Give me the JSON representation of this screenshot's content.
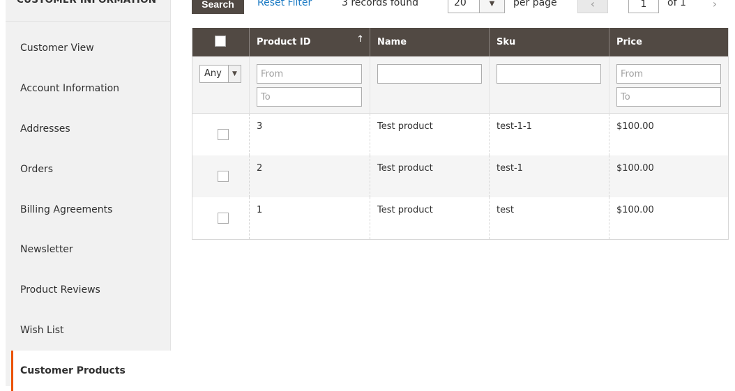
{
  "sidebar": {
    "title": "Customer Information",
    "items": [
      {
        "label": "Customer View"
      },
      {
        "label": "Account Information"
      },
      {
        "label": "Addresses"
      },
      {
        "label": "Orders"
      },
      {
        "label": "Billing Agreements"
      },
      {
        "label": "Newsletter"
      },
      {
        "label": "Product Reviews"
      },
      {
        "label": "Wish List"
      },
      {
        "label": "Customer Products"
      }
    ],
    "active_item": "Customer Products"
  },
  "toolbar": {
    "search_label": "Search",
    "reset_label": "Reset Filter",
    "records_text": "3 records found",
    "per_page_value": "20",
    "per_page_label": "per page",
    "current_page": "1",
    "of_pages": "of 1"
  },
  "grid": {
    "columns": [
      "Product ID",
      "Name",
      "Sku",
      "Price"
    ],
    "filters": {
      "any_value": "Any",
      "id_from_placeholder": "From",
      "id_to_placeholder": "To",
      "price_from_placeholder": "From",
      "price_to_placeholder": "To"
    },
    "rows": [
      {
        "id": "3",
        "name": "Test product",
        "sku": "test-1-1",
        "price": "$100.00"
      },
      {
        "id": "2",
        "name": "Test product",
        "sku": "test-1",
        "price": "$100.00"
      },
      {
        "id": "1",
        "name": "Test product",
        "sku": "test",
        "price": "$100.00"
      }
    ]
  },
  "colors": {
    "accent": "#eb5202",
    "header_bg": "#514943",
    "link": "#1979c3"
  }
}
